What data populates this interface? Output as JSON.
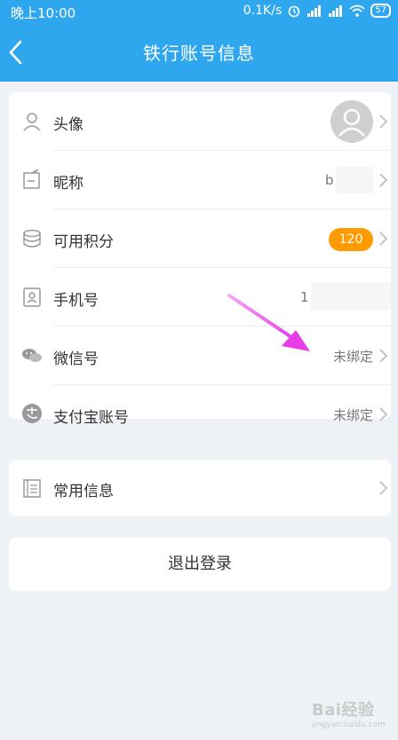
{
  "status_bar": {
    "time": "晚上10:00",
    "speed": "0.1K/s",
    "battery": "57"
  },
  "header": {
    "title": "铁行账号信息"
  },
  "rows": [
    {
      "label": "头像",
      "icon": "person-icon"
    },
    {
      "label": "昵称",
      "value": "b",
      "icon": "edit-icon"
    },
    {
      "label": "可用积分",
      "value": "120",
      "icon": "coins-icon"
    },
    {
      "label": "手机号",
      "value": "1",
      "icon": "phone-card-icon"
    },
    {
      "label": "微信号",
      "value": "未绑定",
      "icon": "wechat-icon"
    },
    {
      "label": "支付宝账号",
      "value": "未绑定",
      "icon": "alipay-icon"
    }
  ],
  "common_info": {
    "label": "常用信息",
    "icon": "document-icon"
  },
  "logout_label": "退出登录",
  "watermark": {
    "brand": "Bai经验",
    "url": "jingyan.baidu.com"
  },
  "colors": {
    "header": "#2ea7ef",
    "badge": "#ff9b00",
    "annotation_arrow": "#e83ee8",
    "background": "#eef2f6"
  }
}
